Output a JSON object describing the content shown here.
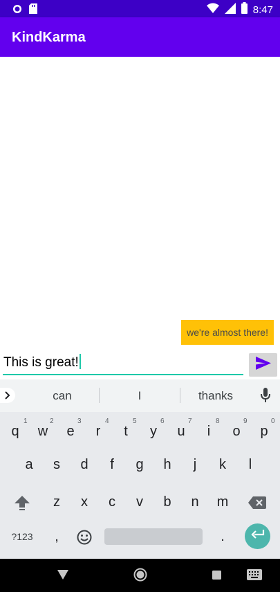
{
  "status_bar": {
    "time": "8:47",
    "icons": [
      "circle-icon",
      "sd-card-icon",
      "wifi-icon",
      "signal-icon",
      "battery-icon"
    ]
  },
  "app_bar": {
    "title": "KindKarma"
  },
  "chat": {
    "messages": [
      {
        "text": "we're almost there!",
        "color": "#ffc107"
      }
    ]
  },
  "composer": {
    "input_value": "This is great!",
    "send_icon": "send-icon"
  },
  "keyboard": {
    "suggestions": [
      "can",
      "I",
      "thanks"
    ],
    "row1": [
      "q",
      "w",
      "e",
      "r",
      "t",
      "y",
      "u",
      "i",
      "o",
      "p"
    ],
    "row1_hints": [
      "1",
      "2",
      "3",
      "4",
      "5",
      "6",
      "7",
      "8",
      "9",
      "0"
    ],
    "row2": [
      "a",
      "s",
      "d",
      "f",
      "g",
      "h",
      "j",
      "k",
      "l"
    ],
    "row3": [
      "z",
      "x",
      "c",
      "v",
      "b",
      "n",
      "m"
    ],
    "symbols_label": "?123",
    "comma": ",",
    "period": "."
  },
  "colors": {
    "status_bar": "#3d00c6",
    "app_bar": "#6200ee",
    "accent": "#1ec8a9",
    "bubble": "#ffc107",
    "enter_key": "#4db6ac"
  }
}
